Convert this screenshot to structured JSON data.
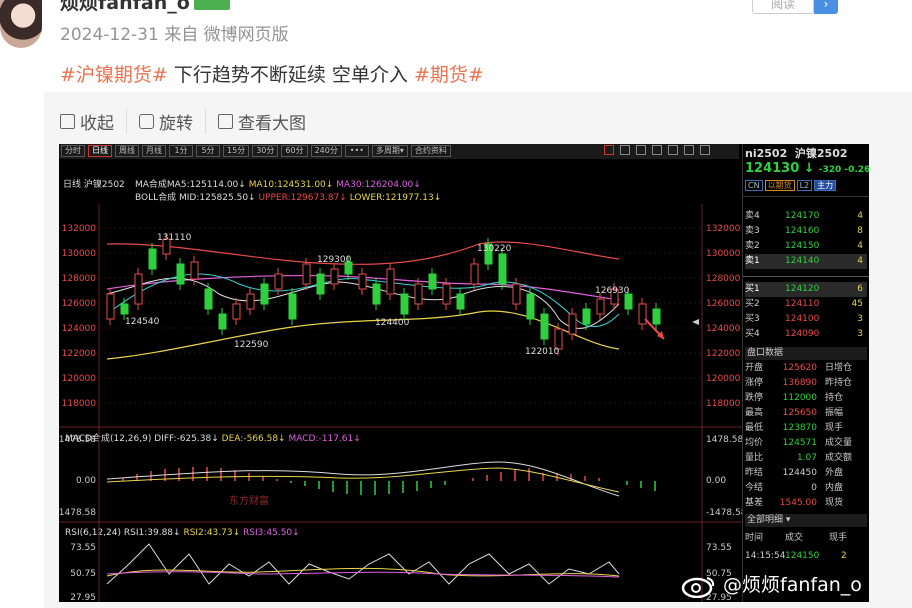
{
  "post": {
    "username": "烦烦fanfan_o",
    "date": "2024-12-31",
    "source": "来自 微博网页版",
    "follow_label": "阅读",
    "text_tag1": "#沪镍期货#",
    "text_body": " 下行趋势不断延续 空单介入",
    "text_tag2": "#期货#"
  },
  "tools": [
    {
      "label": "收起",
      "icon": "collapse-icon"
    },
    {
      "label": "旋转",
      "icon": "rotate-icon"
    },
    {
      "label": "查看大图",
      "icon": "zoom-icon"
    }
  ],
  "watermark": "@烦烦fanfan_o",
  "trading": {
    "toolbar": [
      "分时",
      "日线",
      "周线",
      "月线",
      "1分",
      "5分",
      "15分",
      "30分",
      "60分",
      "240分",
      "•••",
      "多周期▾",
      "合约资料"
    ],
    "title_line": "日线 沪镍2502",
    "ma_line": {
      "ma5": "MA合成MA5:125114.00↓",
      "ma10": "MA10:124531.00↓",
      "ma30": "MA30:126204.00↓"
    },
    "boll_line": {
      "mid": "BOLL合成 MID:125825.50↓",
      "upper": "UPPER:129673.87↓",
      "lower": "LOWER:121977.13↓"
    },
    "price_axis": [
      "132000",
      "130000",
      "128000",
      "126000",
      "124000",
      "122000",
      "120000",
      "118000"
    ],
    "price_annotations": [
      "131110",
      "124540",
      "122590",
      "129300",
      "124400",
      "130220",
      "122010",
      "126930"
    ],
    "macd_line": {
      "name": "MACD合成(12,26,9)",
      "diff": "DIFF:-625.38↓",
      "dea": "DEA:-566.58↓",
      "macd": "MACD:-117.61↓"
    },
    "macd_axis": [
      "1478.58",
      "0.00",
      "-1478.58"
    ],
    "macd_watermark": "东方财富",
    "rsi_line": {
      "name": "RSI(6,12,24)",
      "rsi1": "RSI1:39.88↓",
      "rsi2": "RSI2:43.73↓",
      "rsi3": "RSI3:45.50↓"
    },
    "rsi_axis": [
      "73.55",
      "50.75",
      "27.95"
    ]
  },
  "quote": {
    "code": "ni2502",
    "name": "沪镍2502",
    "price": "124130",
    "change": "-320 -0.26%",
    "tags": [
      "CN",
      "以期货",
      "L2",
      "主力"
    ],
    "asks": [
      {
        "label": "卖4",
        "price": "124170",
        "qty": "4"
      },
      {
        "label": "卖3",
        "price": "124160",
        "qty": "8"
      },
      {
        "label": "卖2",
        "price": "124150",
        "qty": "4"
      },
      {
        "label": "卖1",
        "price": "124140",
        "qty": "4"
      }
    ],
    "bids": [
      {
        "label": "买1",
        "price": "124120",
        "qty": "6"
      },
      {
        "label": "买2",
        "price": "124110",
        "qty": "45"
      },
      {
        "label": "买3",
        "price": "124100",
        "qty": "3"
      },
      {
        "label": "买4",
        "price": "124090",
        "qty": "3"
      }
    ],
    "stats_title": "盘口数据",
    "stats": [
      {
        "k": "开盘",
        "v": "125620",
        "k2": "日增仓"
      },
      {
        "k": "涨停",
        "v": "136890",
        "k2": "昨持仓"
      },
      {
        "k": "跌停",
        "v": "112000",
        "k2": "持仓"
      },
      {
        "k": "最高",
        "v": "125650",
        "k2": "振幅"
      },
      {
        "k": "最低",
        "v": "123870",
        "k2": "现手"
      },
      {
        "k": "均价",
        "v": "124571",
        "k2": "成交量"
      },
      {
        "k": "量比",
        "v": "1.07",
        "k2": "成交额"
      },
      {
        "k": "昨结",
        "v": "124450",
        "k2": "外盘"
      },
      {
        "k": "今结",
        "v": "0",
        "k2": "内盘"
      },
      {
        "k": "基差",
        "v": "1545.00",
        "k2": "现货"
      }
    ],
    "detail_title": "全部明细",
    "detail_head": [
      "时间",
      "成交",
      "现手"
    ],
    "detail_row": [
      "14:15:54",
      "124150",
      "2"
    ]
  },
  "colors": {
    "tag": "#eb7350",
    "up": "#e84a4a",
    "down": "#2ed13d",
    "ma5": "#dddddd",
    "ma10": "#e8d44a",
    "ma30": "#e060e0"
  }
}
